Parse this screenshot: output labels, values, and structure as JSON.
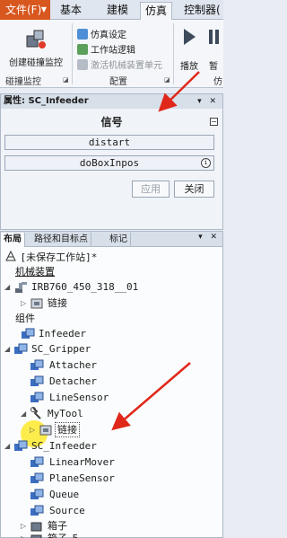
{
  "ribbon": {
    "tabs": [
      {
        "label": "文件(F)",
        "active": false
      },
      {
        "label": "基本",
        "active": false
      },
      {
        "label": "建模",
        "active": false
      },
      {
        "label": "仿真",
        "active": true
      },
      {
        "label": "控制器(",
        "active": false
      }
    ],
    "groups": {
      "collision": {
        "button_label": "创建碰撞监控",
        "group_label": "碰撞监控"
      },
      "config": {
        "items": [
          "仿真设定",
          "工作站逻辑",
          "激活机械装置单元"
        ],
        "group_label": "配置"
      },
      "play": {
        "play_label": "播放",
        "pause_label": "暂",
        "group_label": "仿"
      }
    }
  },
  "properties": {
    "title": "属性: SC_Infeeder",
    "signals_header": "信号",
    "signals": [
      "distart",
      "doBoxInpos"
    ],
    "apply_label": "应用",
    "close_label": "关闭"
  },
  "layout_panel": {
    "tabs": [
      "布局",
      "路径和目标点",
      "标记"
    ],
    "station_title": "[未保存工作站]*",
    "mechanisms_label": "机械装置",
    "robot_name": "IRB760_450_318__01",
    "robot_link": "链接",
    "components_label": "组件",
    "infeeder_top": "Infeeder",
    "gripper": "SC_Gripper",
    "gripper_children": [
      "Attacher",
      "Detacher",
      "LineSensor"
    ],
    "mytool": "MyTool",
    "mytool_link": "链接",
    "sc_infeeder": "SC_Infeeder",
    "sc_infeeder_children": [
      "LinearMover",
      "PlaneSensor",
      "Queue",
      "Source"
    ],
    "boxes": [
      "箱子",
      "箱子_5"
    ]
  },
  "colors": {
    "file_tab": "#d8571f",
    "accent_arrow": "#e0281a",
    "cursor_highlight": "#ffe600"
  }
}
